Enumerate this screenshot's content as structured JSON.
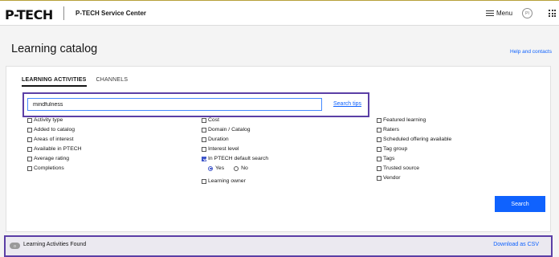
{
  "header": {
    "logo": "P-TECH",
    "service_name": "P-TECH Service Center",
    "menu_label": "Menu",
    "avatar_initials": "PI"
  },
  "page": {
    "title": "Learning catalog",
    "help_link": "Help and contacts"
  },
  "tabs": [
    {
      "label": "LEARNING ACTIVITIES",
      "active": true
    },
    {
      "label": "CHANNELS",
      "active": false
    }
  ],
  "search": {
    "value": "mindfulness",
    "tips_link": "Search tips",
    "button_label": "Search"
  },
  "filters": {
    "column1": [
      {
        "label": "Activity type",
        "checked": false
      },
      {
        "label": "Added to catalog",
        "checked": false
      },
      {
        "label": "Areas of interest",
        "checked": false
      },
      {
        "label": "Available in PTECH",
        "checked": false
      },
      {
        "label": "Average rating",
        "checked": false
      },
      {
        "label": "Completions",
        "checked": false
      }
    ],
    "column2": [
      {
        "label": "Cost",
        "checked": false
      },
      {
        "label": "Domain / Catalog",
        "checked": false
      },
      {
        "label": "Duration",
        "checked": false
      },
      {
        "label": "Interest level",
        "checked": false
      },
      {
        "label": "In PTECH default search",
        "checked": true
      },
      {
        "label": "Learning owner",
        "checked": false
      }
    ],
    "default_search_options": [
      {
        "label": "Yes",
        "selected": true
      },
      {
        "label": "No",
        "selected": false
      }
    ],
    "column3": [
      {
        "label": "Featured learning",
        "checked": false
      },
      {
        "label": "Raters",
        "checked": false
      },
      {
        "label": "Scheduled offering available",
        "checked": false
      },
      {
        "label": "Tag group",
        "checked": false
      },
      {
        "label": "Tags",
        "checked": false
      },
      {
        "label": "Trusted source",
        "checked": false
      },
      {
        "label": "Vendor",
        "checked": false
      }
    ]
  },
  "results": {
    "count": "0",
    "label": "Learning Activities Found",
    "download_link": "Download as CSV"
  },
  "colors": {
    "accent": "#0f62fe",
    "highlight_border": "#5b3fa6",
    "checkbox_checked": "#3d55c9"
  }
}
